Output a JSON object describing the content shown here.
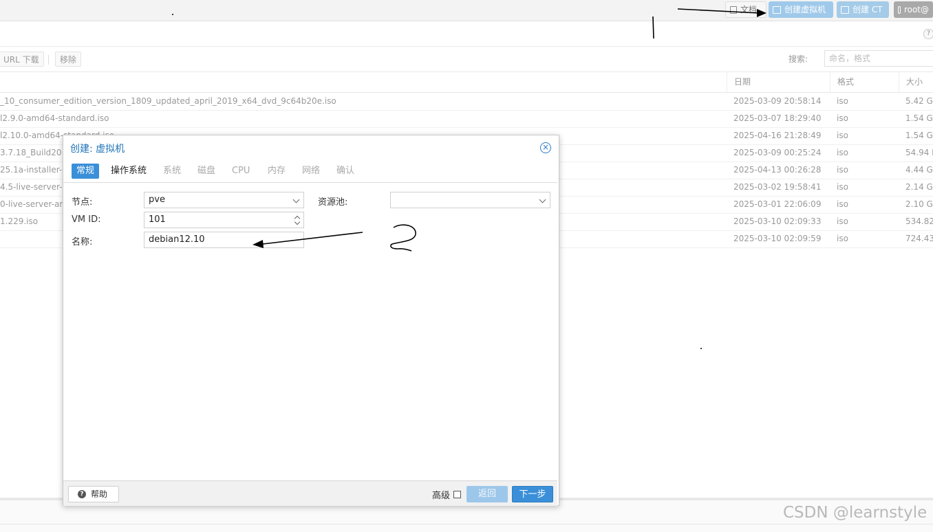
{
  "header": {
    "doc_label": "文档",
    "create_vm_label": "创建虚拟机",
    "create_ct_label": "创建 CT",
    "user_label": "root@"
  },
  "toolbar": {
    "url_download_label": "URL 下载",
    "remove_label": "移除",
    "search_label": "搜索:",
    "search_placeholder": "命名，格式"
  },
  "table": {
    "columns": {
      "date": "日期",
      "format": "格式",
      "size": "大小"
    },
    "rows": [
      {
        "name": "_10_consumer_edition_version_1809_updated_april_2019_x64_dvd_9c64b20e.iso",
        "date": "2025-03-09 20:58:14",
        "format": "iso",
        "size": "5.42 G"
      },
      {
        "name": "l2.9.0-amd64-standard.iso",
        "date": "2025-03-07 18:29:40",
        "format": "iso",
        "size": "1.54 G"
      },
      {
        "name": "l2.10.0-amd64-standard.iso",
        "date": "2025-04-16 21:28:49",
        "format": "iso",
        "size": "1.54 G"
      },
      {
        "name": "3.7.18_Build20",
        "date": "2025-03-09 00:25:24",
        "format": "iso",
        "size": "54.94 M"
      },
      {
        "name": "25.1a-installer-a",
        "date": "2025-04-13 00:26:28",
        "format": "iso",
        "size": "4.44 G"
      },
      {
        "name": "4.5-live-server-a",
        "date": "2025-03-02 19:58:41",
        "format": "iso",
        "size": "2.14 G"
      },
      {
        "name": "0-live-server-am",
        "date": "2025-03-01 22:06:09",
        "format": "iso",
        "size": "2.10 G"
      },
      {
        "name": "1.229.iso",
        "date": "2025-03-10 02:09:33",
        "format": "iso",
        "size": "534.82"
      },
      {
        "name": "",
        "date": "2025-03-10 02:09:59",
        "format": "iso",
        "size": "724.43"
      }
    ]
  },
  "dialog": {
    "title": "创建: 虚拟机",
    "tabs": [
      "常规",
      "操作系统",
      "系统",
      "磁盘",
      "CPU",
      "内存",
      "网络",
      "确认"
    ],
    "node_label": "节点:",
    "node_value": "pve",
    "pool_label": "资源池:",
    "pool_value": "",
    "vmid_label": "VM ID:",
    "vmid_value": "101",
    "name_label": "名称:",
    "name_value": "debian12.10",
    "help_label": "帮助",
    "advanced_label": "高级",
    "back_label": "返回",
    "next_label": "下一步"
  },
  "watermark": "CSDN @learnstyle",
  "colors": {
    "accent": "#3a8fd8",
    "title_blue": "#1e73b9",
    "disabled_blue": "#9dc7ea"
  }
}
